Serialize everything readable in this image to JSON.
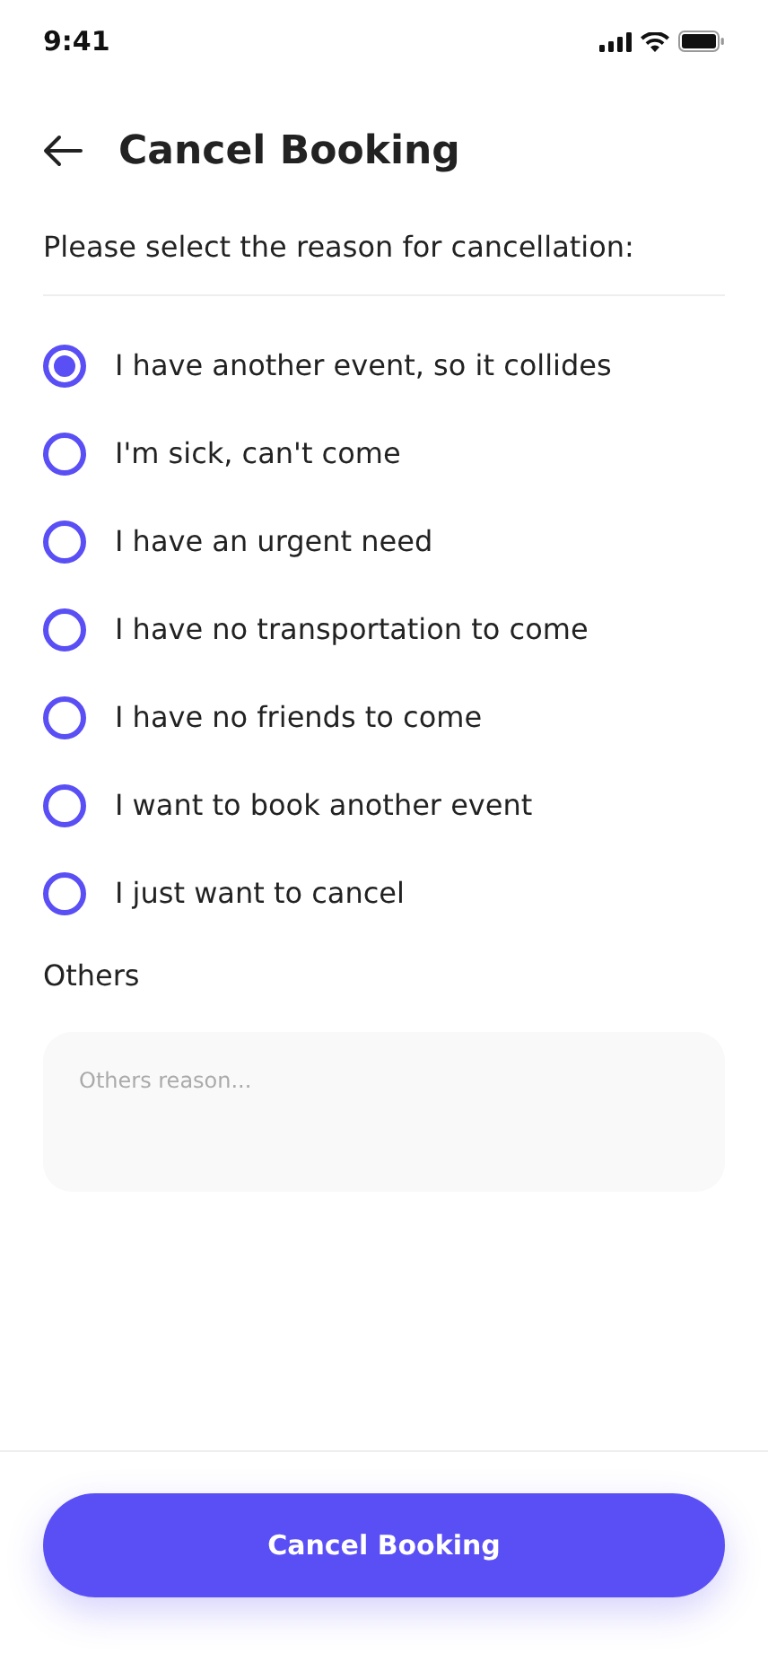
{
  "status_bar": {
    "time": "9:41"
  },
  "header": {
    "title": "Cancel Booking"
  },
  "prompt": "Please select the reason for cancellation:",
  "reasons": [
    {
      "label": "I have another event, so it collides",
      "selected": true
    },
    {
      "label": "I'm sick, can't come",
      "selected": false
    },
    {
      "label": "I have an urgent need",
      "selected": false
    },
    {
      "label": "I have no transportation to come",
      "selected": false
    },
    {
      "label": "I have no friends to come",
      "selected": false
    },
    {
      "label": "I want to book another event",
      "selected": false
    },
    {
      "label": "I just want to cancel",
      "selected": false
    }
  ],
  "others": {
    "label": "Others",
    "placeholder": "Others reason..."
  },
  "button": {
    "label": "Cancel Booking"
  }
}
